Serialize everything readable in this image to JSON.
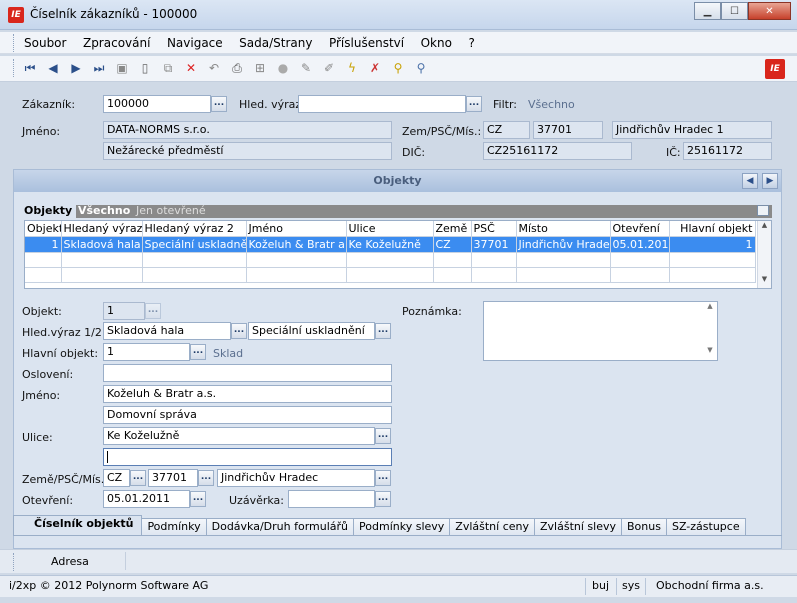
{
  "window": {
    "title": "Číselník zákazníků - 100000",
    "icon_text": "IE"
  },
  "menu": [
    "Soubor",
    "Zpracování",
    "Navigace",
    "Sada/Strany",
    "Příslušenství",
    "Okno",
    "?"
  ],
  "toolbar_icons": [
    "first-record-icon",
    "prev-record-icon",
    "next-record-icon",
    "last-record-icon",
    "save-icon",
    "new-icon",
    "copy-icon",
    "delete-icon",
    "undo-icon",
    "print-icon",
    "structure-icon",
    "disc-icon",
    "edit-icon",
    "edit2-icon",
    "flash-icon",
    "filter-icon",
    "search-icon",
    "search-user-icon"
  ],
  "header": {
    "zakaznik_label": "Zákazník:",
    "zakaznik_value": "100000",
    "hled_label": "Hled. výraz:",
    "hled_value": "",
    "filtr_label": "Filtr:",
    "filtr_value": "Všechno",
    "jmeno_label": "Jméno:",
    "jmeno1": "DATA-NORMS s.r.o.",
    "jmeno2": "Nežárecké předměstí",
    "zem_label": "Zem/PSČ/Mís.:",
    "zem": "CZ",
    "psc": "37701",
    "misto": "Jindřichův Hradec 1",
    "dic_label": "DIČ:",
    "dic": "CZ25161172",
    "ic_label": "IČ:",
    "ic": "25161172"
  },
  "panel": {
    "title": "Objekty",
    "subtabs": [
      "Objekty",
      "Všechno",
      "Jen otevřené"
    ],
    "columns": [
      "Objekt",
      "Hledaný výraz 1",
      "Hledaný výraz 2",
      "Jméno",
      "Ulice",
      "Země",
      "PSČ",
      "Místo",
      "Otevření",
      "Hlavní objekt"
    ],
    "rows": [
      [
        "1",
        "Skladová hala",
        "Speciální uskladnění",
        "Koželuh & Bratr a.s.",
        "Ke Koželužně",
        "CZ",
        "37701",
        "Jindřichův Hradec",
        "05.01.2011",
        "1"
      ]
    ]
  },
  "detail": {
    "objekt_label": "Objekt:",
    "objekt": "1",
    "hled12_label": "Hled.výraz 1/2:",
    "hled1": "Skladová hala",
    "hled2": "Speciální uskladnění",
    "hlavni_label": "Hlavní objekt:",
    "hlavni": "1",
    "hlavni_desc": "Sklad",
    "osloveni_label": "Oslovení:",
    "osloveni": "",
    "jmeno_label": "Jméno:",
    "jmeno1": "Koželuh & Bratr a.s.",
    "jmeno2": "Domovní správa",
    "ulice_label": "Ulice:",
    "ulice1": "Ke Koželužně",
    "ulice2": "",
    "zem_label": "Země/PSČ/Mís.:",
    "zem": "CZ",
    "psc": "37701",
    "misto": "Jindřichův Hradec",
    "otevreni_label": "Otevření:",
    "otevreni": "05.01.2011",
    "uzaverka_label": "Uzávěrka:",
    "uzaverka": "",
    "poznamka_label": "Poznámka:"
  },
  "tabs": [
    "Číselník objektů",
    "Podmínky",
    "Dodávka/Druh formulářů",
    "Podmínky slevy",
    "Zvláštní ceny",
    "Zvláštní slevy",
    "Bonus",
    "SZ-zástupce"
  ],
  "bottom": {
    "adresa": "Adresa"
  },
  "status": {
    "copyright": "i/2xp © 2012 Polynorm Software AG",
    "user": "buj",
    "sys": "sys",
    "firm": "Obchodní firma a.s."
  }
}
